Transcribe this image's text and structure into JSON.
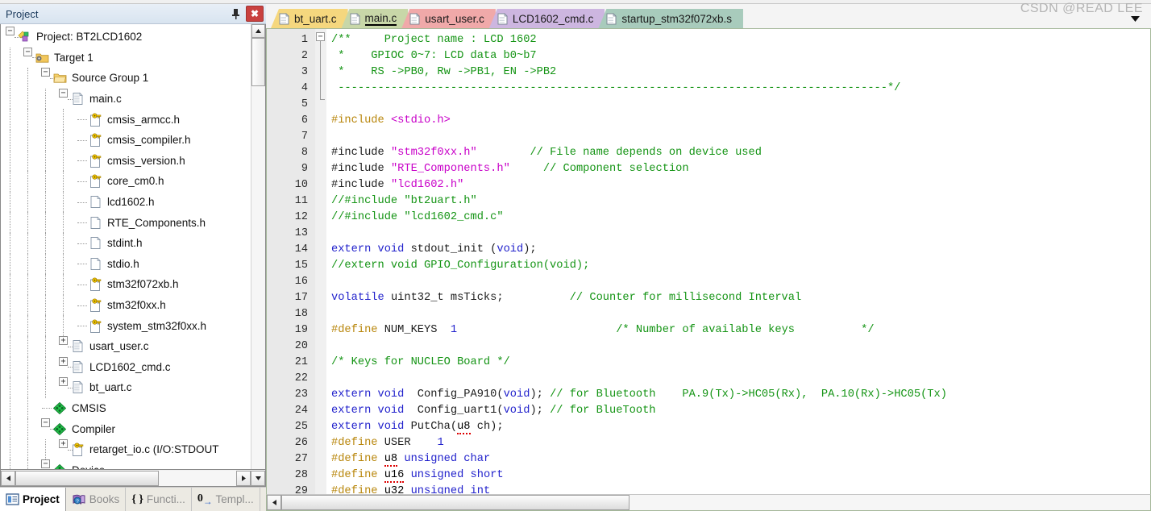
{
  "panel": {
    "title": "Project",
    "pin_icon": "pin-icon",
    "close_label": "✖"
  },
  "tree": [
    {
      "label": "Project: BT2LCD1602",
      "depth": 0,
      "expander": "-",
      "icon": "project-icon"
    },
    {
      "label": "Target 1",
      "depth": 1,
      "expander": "-",
      "icon": "target-folder-icon"
    },
    {
      "label": "Source Group 1",
      "depth": 2,
      "expander": "-",
      "icon": "folder-icon"
    },
    {
      "label": "main.c",
      "depth": 3,
      "expander": "-",
      "icon": "c-file-icon"
    },
    {
      "label": "cmsis_armcc.h",
      "depth": 4,
      "expander": "",
      "icon": "readonly-header-icon"
    },
    {
      "label": "cmsis_compiler.h",
      "depth": 4,
      "expander": "",
      "icon": "readonly-header-icon"
    },
    {
      "label": "cmsis_version.h",
      "depth": 4,
      "expander": "",
      "icon": "readonly-header-icon"
    },
    {
      "label": "core_cm0.h",
      "depth": 4,
      "expander": "",
      "icon": "readonly-header-icon"
    },
    {
      "label": "lcd1602.h",
      "depth": 4,
      "expander": "",
      "icon": "header-icon"
    },
    {
      "label": "RTE_Components.h",
      "depth": 4,
      "expander": "",
      "icon": "header-icon"
    },
    {
      "label": "stdint.h",
      "depth": 4,
      "expander": "",
      "icon": "header-icon"
    },
    {
      "label": "stdio.h",
      "depth": 4,
      "expander": "",
      "icon": "header-icon"
    },
    {
      "label": "stm32f072xb.h",
      "depth": 4,
      "expander": "",
      "icon": "readonly-header-icon"
    },
    {
      "label": "stm32f0xx.h",
      "depth": 4,
      "expander": "",
      "icon": "readonly-header-icon"
    },
    {
      "label": "system_stm32f0xx.h",
      "depth": 4,
      "expander": "",
      "icon": "readonly-header-icon"
    },
    {
      "label": "usart_user.c",
      "depth": 3,
      "expander": "+",
      "icon": "c-file-icon"
    },
    {
      "label": "LCD1602_cmd.c",
      "depth": 3,
      "expander": "+",
      "icon": "c-file-icon"
    },
    {
      "label": "bt_uart.c",
      "depth": 3,
      "expander": "+",
      "icon": "c-file-icon"
    },
    {
      "label": "CMSIS",
      "depth": 2,
      "expander": "",
      "icon": "component-icon"
    },
    {
      "label": "Compiler",
      "depth": 2,
      "expander": "-",
      "icon": "component-icon"
    },
    {
      "label": "retarget_io.c (I/O:STDOUT",
      "depth": 3,
      "expander": "+",
      "icon": "readonly-header-icon"
    },
    {
      "label": "Device",
      "depth": 2,
      "expander": "-",
      "icon": "component-icon"
    }
  ],
  "bottom_tabs": [
    {
      "label": "Project",
      "icon": "project-window-icon",
      "active": true
    },
    {
      "label": "Books",
      "icon": "books-icon",
      "active": false
    },
    {
      "label": "Functi...",
      "icon": "braces-icon",
      "active": false
    },
    {
      "label": "Templ...",
      "icon": "template-icon",
      "active": false
    }
  ],
  "editor_tabs": [
    {
      "label": "bt_uart.c",
      "color": "#f5d77e",
      "active": false
    },
    {
      "label": "main.c",
      "color": "#c8d7a8",
      "active": true
    },
    {
      "label": "usart_user.c",
      "color": "#f0a9a9",
      "active": false
    },
    {
      "label": "LCD1602_cmd.c",
      "color": "#cdb6e0",
      "active": false
    },
    {
      "label": "startup_stm32f072xb.s",
      "color": "#a8cbbc",
      "active": false
    }
  ],
  "tab_dropdown_icon": "chevron-down-icon",
  "watermark": "CSDN @READ LEE",
  "colors": {
    "comment": "#149414",
    "keyword": "#2222cc",
    "preprocessor": "#b8860b",
    "string": "#c800c8"
  },
  "code": {
    "first_line": 1,
    "lines": [
      {
        "n": 1,
        "tokens": [
          {
            "t": "/**     Project name : LCD 1602",
            "c": "cmt"
          }
        ]
      },
      {
        "n": 2,
        "tokens": [
          {
            "t": " *    GPIOC 0~7: LCD data b0~b7",
            "c": "cmt"
          }
        ]
      },
      {
        "n": 3,
        "tokens": [
          {
            "t": " *    RS ->PB0, Rw ->PB1, EN ->PB2",
            "c": "cmt"
          }
        ]
      },
      {
        "n": 4,
        "tokens": [
          {
            "t": " -----------------------------------------------------------------------------------*/",
            "c": "cmt"
          }
        ]
      },
      {
        "n": 5,
        "tokens": []
      },
      {
        "n": 6,
        "tokens": [
          {
            "t": "#include ",
            "c": "pp"
          },
          {
            "t": "<stdio.h>",
            "c": "str"
          }
        ]
      },
      {
        "n": 7,
        "tokens": []
      },
      {
        "n": 8,
        "tokens": [
          {
            "t": "#include ",
            "c": "plain"
          },
          {
            "t": "\"stm32f0xx.h\"",
            "c": "str"
          },
          {
            "t": "        ",
            "c": "plain"
          },
          {
            "t": "// File name depends on device used",
            "c": "cmt"
          }
        ]
      },
      {
        "n": 9,
        "tokens": [
          {
            "t": "#include ",
            "c": "plain"
          },
          {
            "t": "\"RTE_Components.h\"",
            "c": "str"
          },
          {
            "t": "     ",
            "c": "plain"
          },
          {
            "t": "// Component selection",
            "c": "cmt"
          }
        ]
      },
      {
        "n": 10,
        "tokens": [
          {
            "t": "#include ",
            "c": "plain"
          },
          {
            "t": "\"lcd1602.h\"",
            "c": "str"
          }
        ]
      },
      {
        "n": 11,
        "tokens": [
          {
            "t": "//#include \"bt2uart.h\"",
            "c": "cmt"
          }
        ]
      },
      {
        "n": 12,
        "tokens": [
          {
            "t": "//#include \"lcd1602_cmd.c\"",
            "c": "cmt"
          }
        ]
      },
      {
        "n": 13,
        "tokens": []
      },
      {
        "n": 14,
        "tokens": [
          {
            "t": "extern void ",
            "c": "kw"
          },
          {
            "t": "stdout_init (",
            "c": "plain"
          },
          {
            "t": "void",
            "c": "kw"
          },
          {
            "t": ");",
            "c": "plain"
          }
        ]
      },
      {
        "n": 15,
        "tokens": [
          {
            "t": "//extern void GPIO_Configuration(void);",
            "c": "cmt"
          }
        ]
      },
      {
        "n": 16,
        "tokens": []
      },
      {
        "n": 17,
        "tokens": [
          {
            "t": "volatile ",
            "c": "kw"
          },
          {
            "t": "uint32_t msTicks;",
            "c": "plain"
          },
          {
            "t": "          ",
            "c": "plain"
          },
          {
            "t": "// Counter for millisecond Interval",
            "c": "cmt"
          }
        ]
      },
      {
        "n": 18,
        "tokens": []
      },
      {
        "n": 19,
        "tokens": [
          {
            "t": "#define ",
            "c": "pp"
          },
          {
            "t": "NUM_KEYS  ",
            "c": "plain"
          },
          {
            "t": "1",
            "c": "num"
          },
          {
            "t": "                        ",
            "c": "plain"
          },
          {
            "t": "/* Number of available keys          */",
            "c": "cmt"
          }
        ]
      },
      {
        "n": 20,
        "tokens": []
      },
      {
        "n": 21,
        "tokens": [
          {
            "t": "/* Keys for NUCLEO Board */",
            "c": "cmt"
          }
        ]
      },
      {
        "n": 22,
        "tokens": []
      },
      {
        "n": 23,
        "tokens": [
          {
            "t": "extern void ",
            "c": "kw"
          },
          {
            "t": " Config_PA910(",
            "c": "plain"
          },
          {
            "t": "void",
            "c": "kw"
          },
          {
            "t": "); ",
            "c": "plain"
          },
          {
            "t": "// for Bluetooth    PA.9(Tx)->HC05(Rx),  PA.10(Rx)->HC05(Tx)",
            "c": "cmt"
          }
        ]
      },
      {
        "n": 24,
        "tokens": [
          {
            "t": "extern void ",
            "c": "kw"
          },
          {
            "t": " Config_uart1(",
            "c": "plain"
          },
          {
            "t": "void",
            "c": "kw"
          },
          {
            "t": "); ",
            "c": "plain"
          },
          {
            "t": "// for BlueTooth",
            "c": "cmt"
          }
        ]
      },
      {
        "n": 25,
        "tokens": [
          {
            "t": "extern void ",
            "c": "kw"
          },
          {
            "t": "PutCha(",
            "c": "plain"
          },
          {
            "t": "u8",
            "c": "sq"
          },
          {
            "t": " ch);",
            "c": "plain"
          }
        ]
      },
      {
        "n": 26,
        "tokens": [
          {
            "t": "#define ",
            "c": "pp"
          },
          {
            "t": "USER    ",
            "c": "plain"
          },
          {
            "t": "1",
            "c": "num"
          }
        ]
      },
      {
        "n": 27,
        "tokens": [
          {
            "t": "#define ",
            "c": "pp"
          },
          {
            "t": "u8",
            "c": "sq"
          },
          {
            "t": " ",
            "c": "plain"
          },
          {
            "t": "unsigned char",
            "c": "kw"
          }
        ]
      },
      {
        "n": 28,
        "tokens": [
          {
            "t": "#define ",
            "c": "pp"
          },
          {
            "t": "u16",
            "c": "sq"
          },
          {
            "t": " ",
            "c": "plain"
          },
          {
            "t": "unsigned short",
            "c": "kw"
          }
        ]
      },
      {
        "n": 29,
        "tokens": [
          {
            "t": "#define ",
            "c": "pp"
          },
          {
            "t": "u32",
            "c": "sq"
          },
          {
            "t": " ",
            "c": "plain"
          },
          {
            "t": "unsigned int",
            "c": "kw"
          }
        ]
      }
    ]
  }
}
